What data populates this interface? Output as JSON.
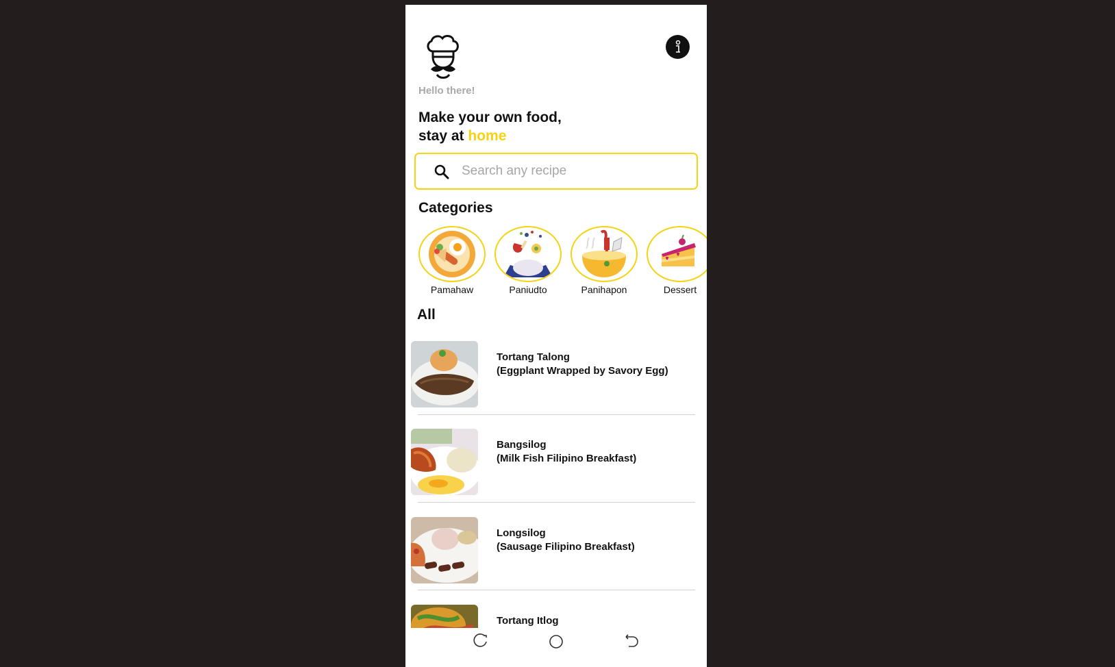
{
  "header": {
    "logo_icon": "chef-hat-mustache-icon",
    "info_icon": "info-icon",
    "greeting": "Hello there!",
    "headline_line1": "Make your own food,",
    "headline_line2_prefix": "stay at ",
    "headline_line2_accent": "home",
    "accent_color": "#f5d313"
  },
  "search": {
    "placeholder": "Search any recipe",
    "value": "",
    "icon": "search-icon"
  },
  "categories": {
    "title": "Categories",
    "items": [
      {
        "label": "Pamahaw",
        "icon": "breakfast-plate-icon"
      },
      {
        "label": "Paniudto",
        "icon": "lunch-rice-chicken-icon"
      },
      {
        "label": "Panihapon",
        "icon": "dinner-soup-bowl-icon"
      },
      {
        "label": "Dessert",
        "icon": "cake-slice-icon"
      }
    ]
  },
  "all": {
    "title": "All",
    "recipes": [
      {
        "name": "Tortang Talong",
        "subtitle": "(Eggplant Wrapped by Savory Egg)"
      },
      {
        "name": "Bangsilog",
        "subtitle": "(Milk Fish Filipino Breakfast)"
      },
      {
        "name": "Longsilog",
        "subtitle": "(Sausage Filipino Breakfast)"
      },
      {
        "name": "Tortang Itlog",
        "subtitle": ""
      }
    ]
  },
  "navbar": {
    "recent_icon": "recent-apps-icon",
    "home_icon": "home-circle-icon",
    "back_icon": "back-icon"
  }
}
